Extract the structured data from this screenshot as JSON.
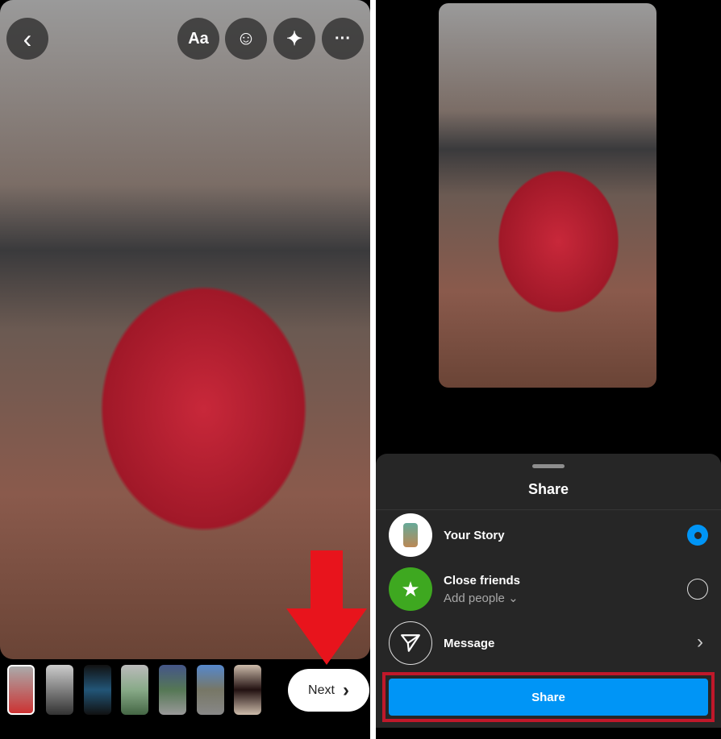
{
  "editor": {
    "top_icons": [
      {
        "name": "back-icon",
        "glyph": "‹"
      },
      {
        "name": "text-icon",
        "glyph": "Aa"
      },
      {
        "name": "sticker-icon",
        "glyph": "☺"
      },
      {
        "name": "effects-icon",
        "glyph": "✦"
      },
      {
        "name": "more-icon",
        "glyph": "···"
      }
    ],
    "thumbnail_count": 7,
    "next_label": "Next",
    "next_chevron": "›",
    "annotation_color": "#e8141c"
  },
  "share_sheet": {
    "title": "Share",
    "your_story": {
      "label": "Your Story",
      "selected": true
    },
    "close_friends": {
      "label": "Close friends",
      "sub": "Add people",
      "selected": false
    },
    "message": {
      "label": "Message"
    },
    "share_button": "Share",
    "accent": "#0095f6",
    "highlight_color": "#c0182a"
  }
}
